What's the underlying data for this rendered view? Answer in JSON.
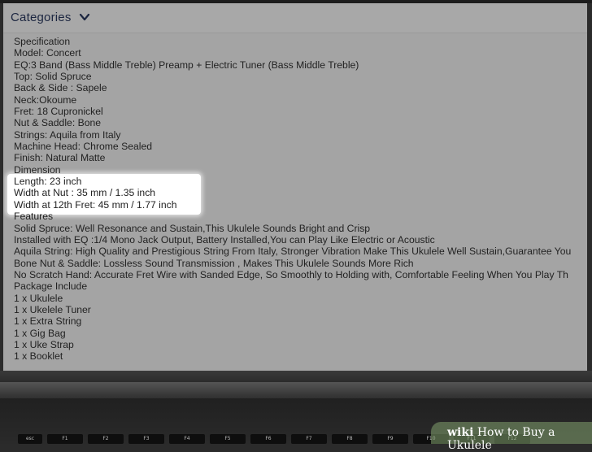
{
  "header": {
    "title": "Categories"
  },
  "spec_lines": [
    "Specification",
    "Model: Concert",
    "EQ:3 Band (Bass Middle Treble) Preamp + Electric Tuner (Bass Middle Treble)",
    "Top: Solid Spruce",
    "Back & Side : Sapele",
    "Neck:Okoume",
    "Fret: 18 Cupronickel",
    "Nut & Saddle: Bone",
    "Strings: Aquila from Italy",
    "Machine Head: Chrome Sealed",
    "Finish: Natural Matte",
    "Dimension",
    "Length: 23 inch",
    "Width at Nut : 35 mm / 1.35 inch",
    "Width at 12th Fret: 45 mm / 1.77 inch",
    "Features",
    "Solid Spruce: Well Resonance and Sustain,This Ukulele Sounds Bright and Crisp",
    "Installed with EQ :1/4 Mono Jack Output, Battery Installed,You can Play Like Electric or Acoustic",
    "Aquila String: High Quality and Prestigious String From Italy, Stronger Vibration Make This Ukulele Well Sustain,Guarantee You",
    "Bone Nut & Saddle: Lossless Sound Transmission , Makes This Ukulele Sounds More Rich",
    "No Scratch Hand: Accurate Fret Wire with Sanded Edge, So Smoothly to Holding with, Comfortable Feeling When You Play Th",
    "Package Include",
    "1 x Ukulele",
    "1 x Ukelele Tuner",
    "1 x Extra String",
    "1 x Gig Bag",
    "1 x Uke Strap",
    "1 x Booklet"
  ],
  "keyboard_keys": [
    "esc",
    "F1",
    "F2",
    "F3",
    "F4",
    "F5",
    "F6",
    "F7",
    "F8",
    "F9",
    "F10",
    "F11",
    "F12"
  ],
  "watermark": {
    "brand": "wiki",
    "text": "How to Buy a Ukulele"
  },
  "icons": {
    "chevron": "chevron-down-icon"
  }
}
